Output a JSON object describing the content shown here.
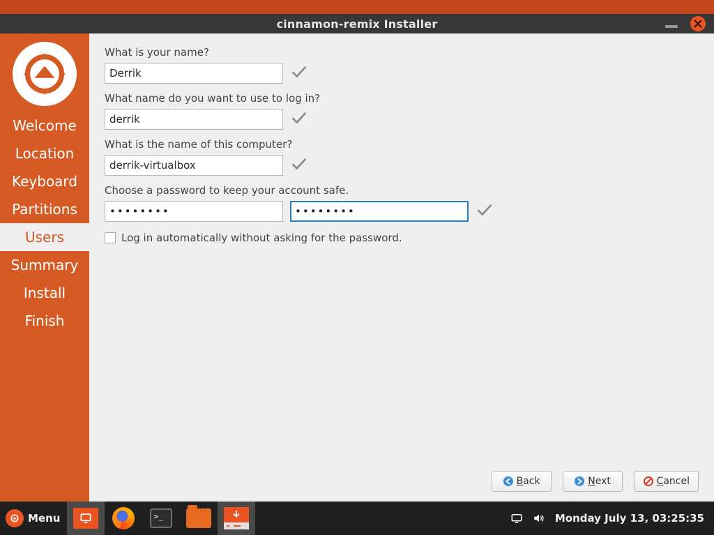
{
  "window": {
    "title": "cinnamon-remix Installer"
  },
  "sidebar": {
    "items": [
      {
        "label": "Welcome"
      },
      {
        "label": "Location"
      },
      {
        "label": "Keyboard"
      },
      {
        "label": "Partitions"
      },
      {
        "label": "Users"
      },
      {
        "label": "Summary"
      },
      {
        "label": "Install"
      },
      {
        "label": "Finish"
      }
    ],
    "active_index": 4
  },
  "form": {
    "name_label": "What is your name?",
    "name_value": "Derrik",
    "login_label": "What name do you want to use to log in?",
    "login_value": "derrik",
    "host_label": "What is the name of this computer?",
    "host_value": "derrik-virtualbox",
    "password_label": "Choose a password to keep your account safe.",
    "password1_value": "••••••••",
    "password2_value": "••••••••",
    "autologin_label": "Log in automatically without asking for the password.",
    "autologin_checked": false
  },
  "buttons": {
    "back": "Back",
    "next": "Next",
    "cancel": "Cancel"
  },
  "taskbar": {
    "menu_label": "Menu",
    "clock": "Monday July 13, 03:25:35"
  }
}
